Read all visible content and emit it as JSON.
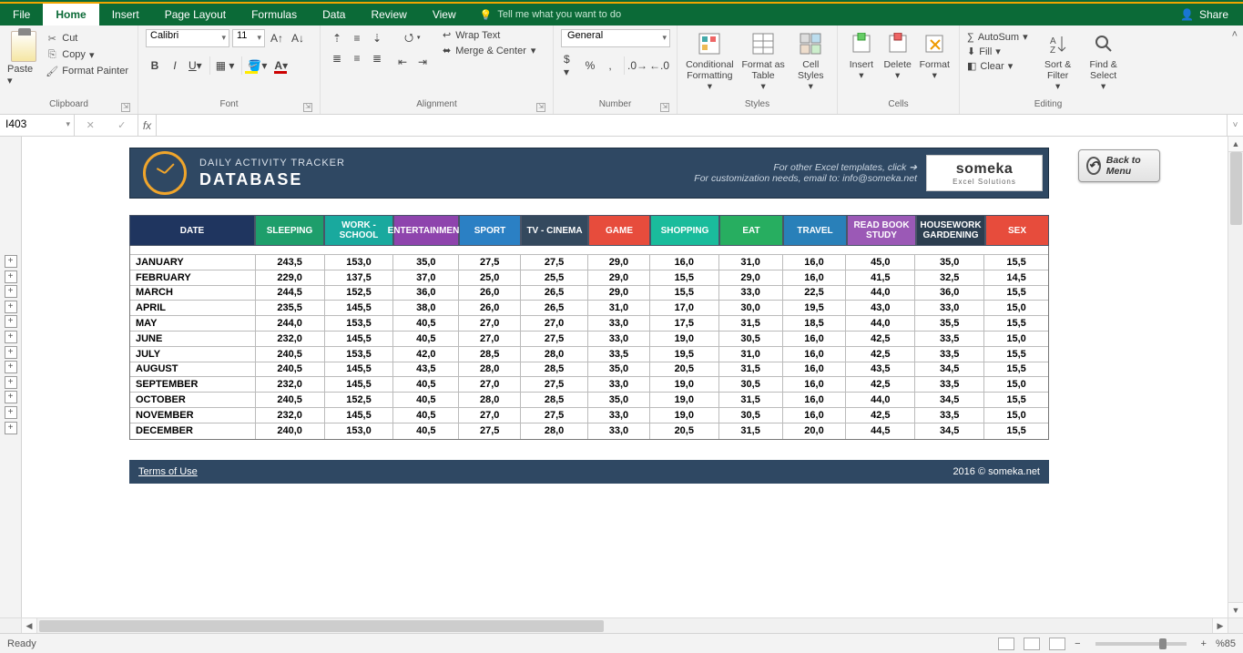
{
  "menu": {
    "file": "File",
    "home": "Home",
    "insert": "Insert",
    "pageLayout": "Page Layout",
    "formulas": "Formulas",
    "data": "Data",
    "review": "Review",
    "view": "View",
    "tell": "Tell me what you want to do",
    "share": "Share"
  },
  "ribbon": {
    "clipboard": {
      "label": "Clipboard",
      "paste": "Paste",
      "cut": "Cut",
      "copy": "Copy",
      "painter": "Format Painter"
    },
    "font": {
      "label": "Font",
      "name": "Calibri",
      "size": "11"
    },
    "alignment": {
      "label": "Alignment",
      "wrap": "Wrap Text",
      "merge": "Merge & Center"
    },
    "number": {
      "label": "Number",
      "format": "General"
    },
    "styles": {
      "label": "Styles",
      "cond": "Conditional Formatting",
      "fat": "Format as Table",
      "cell": "Cell Styles"
    },
    "cells": {
      "label": "Cells",
      "insert": "Insert",
      "delete": "Delete",
      "format": "Format"
    },
    "editing": {
      "label": "Editing",
      "autosum": "AutoSum",
      "fill": "Fill",
      "clear": "Clear",
      "sort": "Sort & Filter",
      "find": "Find & Select"
    }
  },
  "namebox": "I403",
  "tracker": {
    "title1": "DAILY ACTIVITY TRACKER",
    "title2": "DATABASE",
    "note1": "For other Excel templates, click",
    "note2": "For customization needs, email to: info@someka.net",
    "logo": "someka",
    "logosub": "Excel Solutions",
    "backmenu": "Back to Menu",
    "terms": "Terms of Use",
    "copyright": "2016 © someka.net",
    "headers": [
      "DATE",
      "SLEEPING",
      "WORK - SCHOOL",
      "ENTERTAINMENT",
      "SPORT",
      "TV - CINEMA",
      "GAME",
      "SHOPPING",
      "EAT",
      "TRAVEL",
      "READ BOOK STUDY",
      "HOUSEWORK GARDENING",
      "SEX"
    ],
    "rows": [
      {
        "m": "JANUARY",
        "v": [
          "243,5",
          "153,0",
          "35,0",
          "27,5",
          "27,5",
          "29,0",
          "16,0",
          "31,0",
          "16,0",
          "45,0",
          "35,0",
          "15,5"
        ]
      },
      {
        "m": "FEBRUARY",
        "v": [
          "229,0",
          "137,5",
          "37,0",
          "25,0",
          "25,5",
          "29,0",
          "15,5",
          "29,0",
          "16,0",
          "41,5",
          "32,5",
          "14,5"
        ]
      },
      {
        "m": "MARCH",
        "v": [
          "244,5",
          "152,5",
          "36,0",
          "26,0",
          "26,5",
          "29,0",
          "15,5",
          "33,0",
          "22,5",
          "44,0",
          "36,0",
          "15,5"
        ]
      },
      {
        "m": "APRIL",
        "v": [
          "235,5",
          "145,5",
          "38,0",
          "26,0",
          "26,5",
          "31,0",
          "17,0",
          "30,0",
          "19,5",
          "43,0",
          "33,0",
          "15,0"
        ]
      },
      {
        "m": "MAY",
        "v": [
          "244,0",
          "153,5",
          "40,5",
          "27,0",
          "27,0",
          "33,0",
          "17,5",
          "31,5",
          "18,5",
          "44,0",
          "35,5",
          "15,5"
        ]
      },
      {
        "m": "JUNE",
        "v": [
          "232,0",
          "145,5",
          "40,5",
          "27,0",
          "27,5",
          "33,0",
          "19,0",
          "30,5",
          "16,0",
          "42,5",
          "33,5",
          "15,0"
        ]
      },
      {
        "m": "JULY",
        "v": [
          "240,5",
          "153,5",
          "42,0",
          "28,5",
          "28,0",
          "33,5",
          "19,5",
          "31,0",
          "16,0",
          "42,5",
          "33,5",
          "15,5"
        ]
      },
      {
        "m": "AUGUST",
        "v": [
          "240,5",
          "145,5",
          "43,5",
          "28,0",
          "28,5",
          "35,0",
          "20,5",
          "31,5",
          "16,0",
          "43,5",
          "34,5",
          "15,5"
        ]
      },
      {
        "m": "SEPTEMBER",
        "v": [
          "232,0",
          "145,5",
          "40,5",
          "27,0",
          "27,5",
          "33,0",
          "19,0",
          "30,5",
          "16,0",
          "42,5",
          "33,5",
          "15,0"
        ]
      },
      {
        "m": "OCTOBER",
        "v": [
          "240,5",
          "152,5",
          "40,5",
          "28,0",
          "28,5",
          "35,0",
          "19,0",
          "31,5",
          "16,0",
          "44,0",
          "34,5",
          "15,5"
        ]
      },
      {
        "m": "NOVEMBER",
        "v": [
          "232,0",
          "145,5",
          "40,5",
          "27,0",
          "27,5",
          "33,0",
          "19,0",
          "30,5",
          "16,0",
          "42,5",
          "33,5",
          "15,0"
        ]
      },
      {
        "m": "DECEMBER",
        "v": [
          "240,0",
          "153,0",
          "40,5",
          "27,5",
          "28,0",
          "33,0",
          "20,5",
          "31,5",
          "20,0",
          "44,5",
          "34,5",
          "15,5"
        ]
      }
    ]
  },
  "status": {
    "ready": "Ready",
    "zoom": "%85"
  }
}
